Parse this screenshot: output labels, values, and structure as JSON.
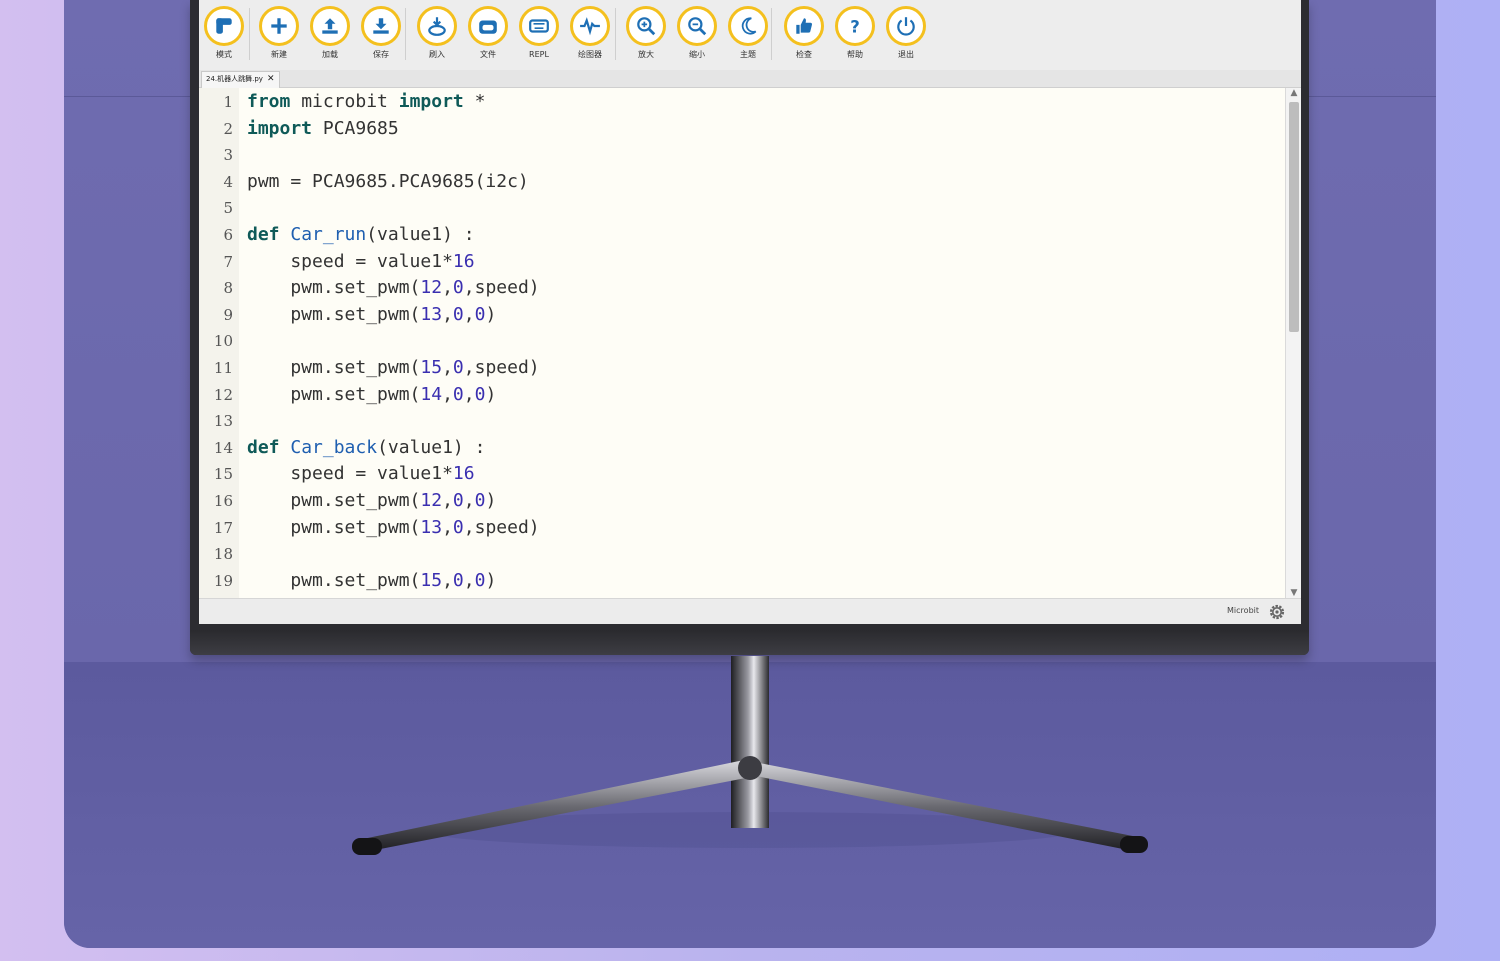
{
  "toolbar": {
    "buttons": [
      {
        "id": "mode",
        "label": "模式",
        "icon": "mode-icon"
      },
      {
        "id": "new",
        "label": "新建",
        "icon": "plus-icon"
      },
      {
        "id": "load",
        "label": "加载",
        "icon": "upload-icon"
      },
      {
        "id": "save",
        "label": "保存",
        "icon": "download-icon"
      },
      {
        "id": "flash",
        "label": "刷入",
        "icon": "flash-icon"
      },
      {
        "id": "files",
        "label": "文件",
        "icon": "folder-icon"
      },
      {
        "id": "repl",
        "label": "REPL",
        "icon": "keyboard-icon"
      },
      {
        "id": "plotter",
        "label": "绘图器",
        "icon": "pulse-icon"
      },
      {
        "id": "zoomin",
        "label": "放大",
        "icon": "zoom-in-icon"
      },
      {
        "id": "zoomout",
        "label": "缩小",
        "icon": "zoom-out-icon"
      },
      {
        "id": "theme",
        "label": "主题",
        "icon": "moon-icon"
      },
      {
        "id": "check",
        "label": "检查",
        "icon": "thumbs-up-icon"
      },
      {
        "id": "help",
        "label": "帮助",
        "icon": "question-icon"
      },
      {
        "id": "quit",
        "label": "退出",
        "icon": "power-icon"
      }
    ]
  },
  "tab": {
    "title": "24.机器人跳舞.py",
    "close": "✕"
  },
  "code_lines": [
    {
      "n": "1",
      "html": "<span class='kw'>from</span> microbit <span class='kw'>import</span> *"
    },
    {
      "n": "2",
      "html": "<span class='kw'>import</span> PCA9685"
    },
    {
      "n": "3",
      "html": ""
    },
    {
      "n": "4",
      "html": "pwm = PCA9685.PCA9685(i2c)"
    },
    {
      "n": "5",
      "html": ""
    },
    {
      "n": "6",
      "html": "<span class='kw'>def</span> <span class='fn'>Car_run</span>(value1) :"
    },
    {
      "n": "7",
      "html": "    speed = value1*<span class='nm'>16</span>"
    },
    {
      "n": "8",
      "html": "    pwm.set_pwm(<span class='nm'>12</span>,<span class='nm'>0</span>,speed)"
    },
    {
      "n": "9",
      "html": "    pwm.set_pwm(<span class='nm'>13</span>,<span class='nm'>0</span>,<span class='nm'>0</span>)"
    },
    {
      "n": "10",
      "html": ""
    },
    {
      "n": "11",
      "html": "    pwm.set_pwm(<span class='nm'>15</span>,<span class='nm'>0</span>,speed)"
    },
    {
      "n": "12",
      "html": "    pwm.set_pwm(<span class='nm'>14</span>,<span class='nm'>0</span>,<span class='nm'>0</span>)"
    },
    {
      "n": "13",
      "html": ""
    },
    {
      "n": "14",
      "html": "<span class='kw'>def</span> <span class='fn'>Car_back</span>(value1) :"
    },
    {
      "n": "15",
      "html": "    speed = value1*<span class='nm'>16</span>"
    },
    {
      "n": "16",
      "html": "    pwm.set_pwm(<span class='nm'>12</span>,<span class='nm'>0</span>,<span class='nm'>0</span>)"
    },
    {
      "n": "17",
      "html": "    pwm.set_pwm(<span class='nm'>13</span>,<span class='nm'>0</span>,speed)"
    },
    {
      "n": "18",
      "html": ""
    },
    {
      "n": "19",
      "html": "    pwm.set_pwm(<span class='nm'>15</span>,<span class='nm'>0</span>,<span class='nm'>0</span>)"
    }
  ],
  "status": {
    "mode": "Microbit",
    "settings_icon": "gear-icon"
  },
  "colors": {
    "accent": "#f4c01e",
    "icon": "#1e6fb5",
    "keyword": "#0f5a58",
    "number": "#3a2fb0"
  }
}
